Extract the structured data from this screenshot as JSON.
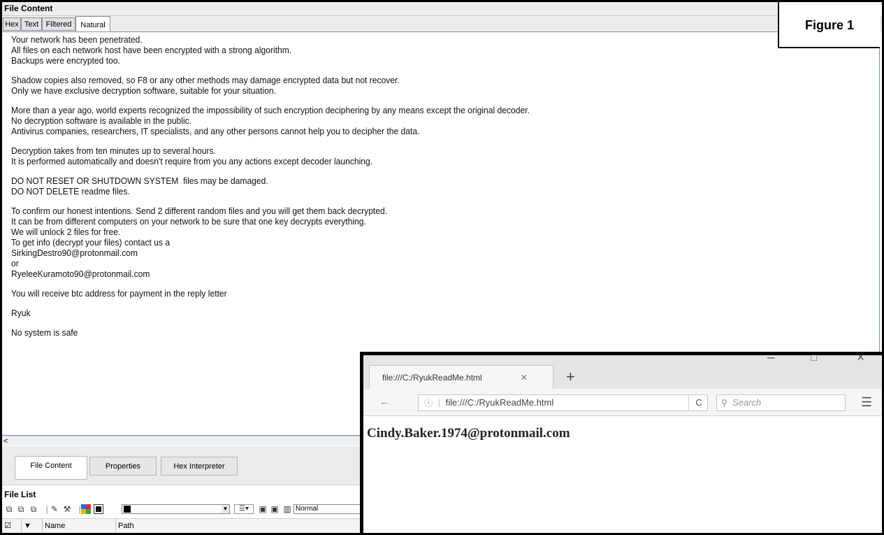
{
  "main_window": {
    "title": "File Content",
    "tabs": [
      "Hex",
      "Text",
      "Filtered",
      "Natural"
    ],
    "active_tab": "Natural",
    "note_lines": [
      "Your network has been penetrated.",
      "All files on each network host have been encrypted with a strong algorithm.",
      "Backups were encrypted too.",
      "",
      "Shadow copies also removed, so F8 or any other methods may damage encrypted data but not recover.",
      "Only we have exclusive decryption software, suitable for your situation.",
      "",
      "More than a year ago, world experts recognized the impossibility of such encryption deciphering by any means except the original decoder.",
      "No decryption software is available in the public.",
      "Antivirus companies, researchers, IT specialists, and any other persons cannot help you to decipher the data.",
      "",
      "Decryption takes from ten minutes up to several hours.",
      "It is performed automatically and doesn't require from you any actions except decoder launching.",
      "",
      "DO NOT RESET OR SHUTDOWN SYSTEM  files may be damaged.",
      "DO NOT DELETE readme files.",
      "",
      "To confirm our honest intentions. Send 2 different random files and you will get them back decrypted.",
      "It can be from different computers on your network to be sure that one key decrypts everything.",
      "We will unlock 2 files for free.",
      "To get info (decrypt your files) contact us a",
      "SirkingDestro90@protonmail.com",
      "or",
      "RyeleeKuramoto90@protonmail.com",
      "",
      "You will receive btc address for payment in the reply letter",
      "",
      "Ryuk",
      "",
      "No system is safe"
    ],
    "scroll_left_glyph": "<",
    "lower_tabs": [
      "File Content",
      "Properties",
      "Hex Interpreter"
    ],
    "file_list_title": "File List",
    "toolbar": {
      "font_style_value": "Normal",
      "icons": [
        "copy-icon",
        "copy-alt-icon",
        "copy-stack-icon",
        "pen-icon",
        "tools-icon",
        "color-grid-icon",
        "grid-view-icon",
        "archive-icon",
        "archive-alt-icon",
        "columns-icon"
      ]
    },
    "columns": [
      "Name",
      "Path"
    ]
  },
  "figure_label": "Figure 1",
  "browser": {
    "tab_title": "file:///C:/RyukReadMe.html",
    "url": "file:///C:/RyukReadMe.html",
    "search_placeholder": "Search",
    "page_text": "Cindy.Baker.1974@protonmail.com"
  }
}
